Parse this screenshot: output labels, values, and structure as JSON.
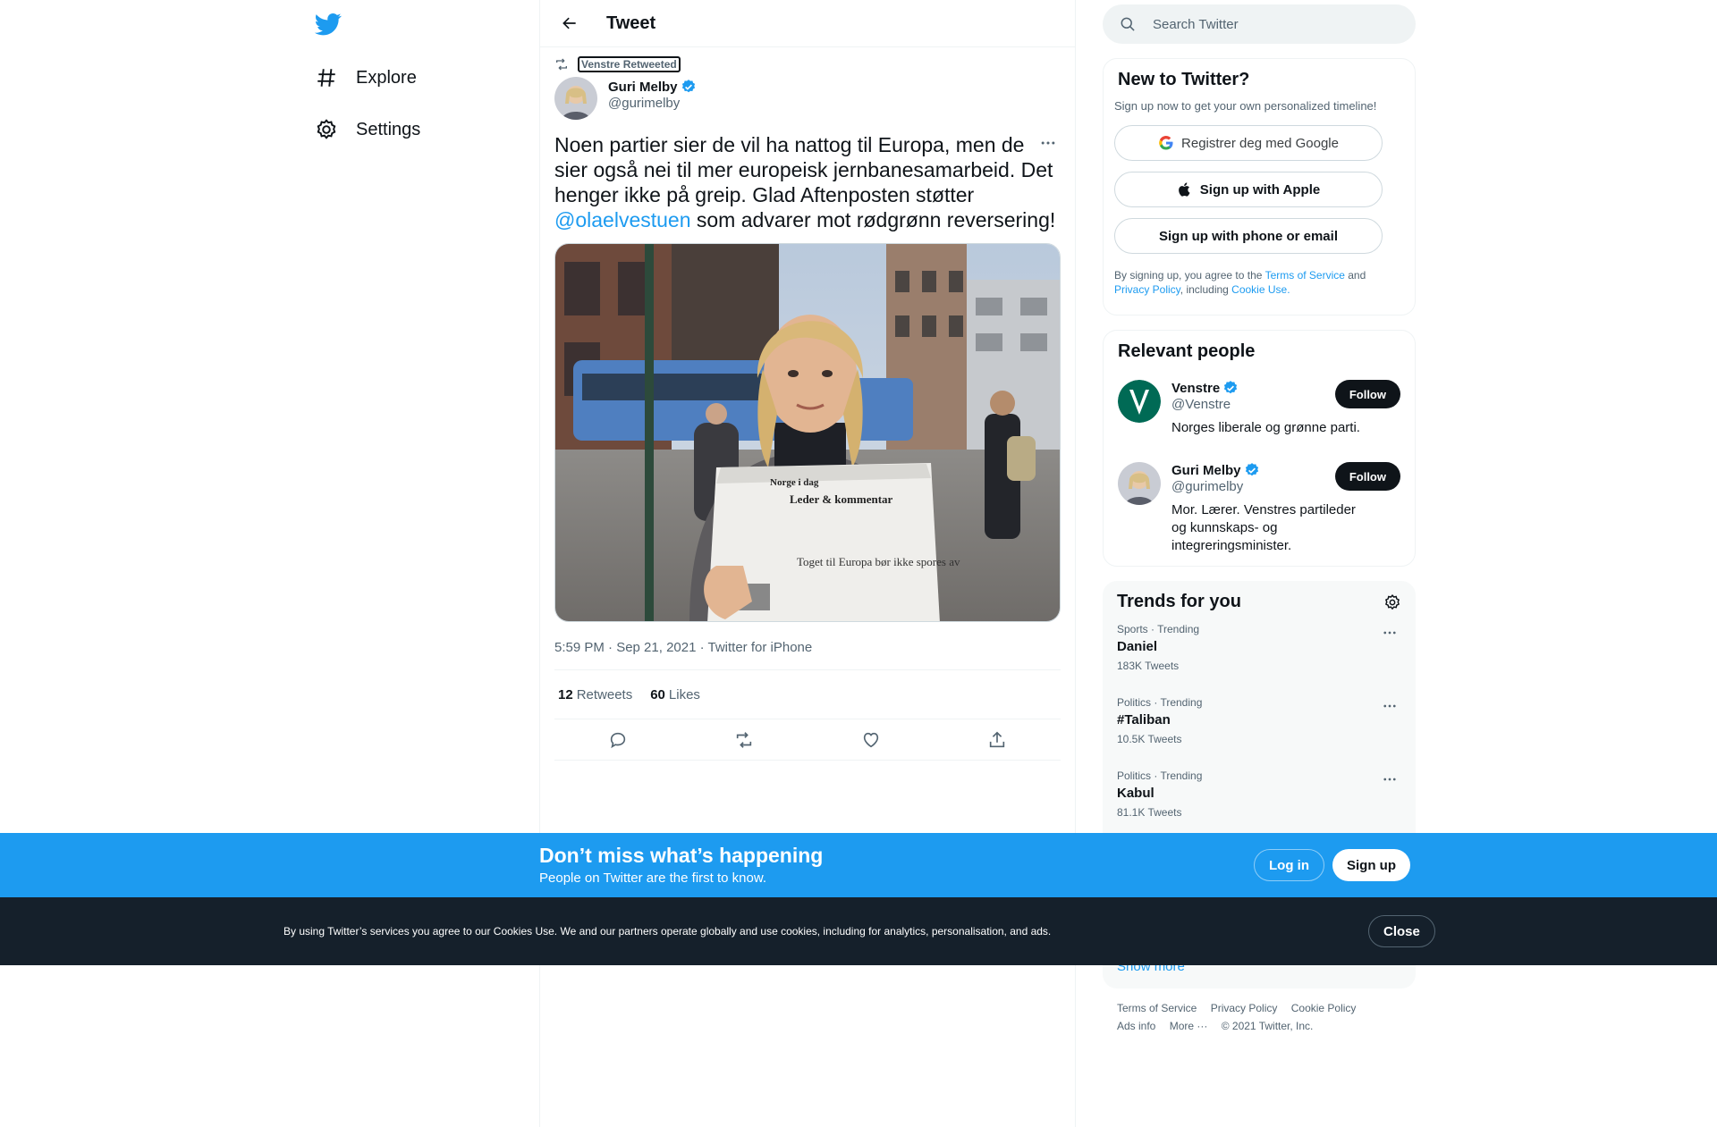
{
  "nav": {
    "explore_label": "Explore",
    "settings_label": "Settings"
  },
  "header": {
    "title": "Tweet"
  },
  "tweet": {
    "retweeted_by": "Venstre Retweeted",
    "author_name": "Guri Melby",
    "author_handle": "@gurimelby",
    "text_before": "Noen partier sier de vil ha nattog til Europa, men de sier også nei til mer europeisk jernbanesamarbeid. Det henger ikke på greip. Glad Aftenposten støtter ",
    "mention": "@olaelvestuen",
    "text_after": " som advarer mot rødgrønn reversering!",
    "image_text_1": "Leder & kommentar",
    "image_text_2": "Toget til Europa bør ikke spores av",
    "image_text_3": "Norge i dag",
    "meta": "5:59 PM · Sep 21, 2021 · Twitter for iPhone",
    "retweets_count": "12",
    "retweets_label": "Retweets",
    "likes_count": "60",
    "likes_label": "Likes"
  },
  "search": {
    "placeholder": "Search Twitter"
  },
  "new_to_twitter": {
    "title": "New to Twitter?",
    "subtitle": "Sign up now to get your own personalized timeline!",
    "google_label": "Registrer deg med Google",
    "apple_label": "Sign up with Apple",
    "phone_label": "Sign up with phone or email",
    "terms_1": "By signing up, you agree to the ",
    "terms_tos": "Terms of Service",
    "terms_2": " and ",
    "terms_privacy": "Privacy Policy",
    "terms_3": ", including ",
    "terms_cookie": "Cookie Use."
  },
  "relevant_people": {
    "title": "Relevant people",
    "people": [
      {
        "name": "Venstre",
        "handle": "@Venstre",
        "bio": "Norges liberale og grønne parti.",
        "follow": "Follow"
      },
      {
        "name": "Guri Melby",
        "handle": "@gurimelby",
        "bio": "Mor. Lærer. Venstres partileder og kunnskaps- og integreringsminister.",
        "follow": "Follow"
      }
    ]
  },
  "trends": {
    "title": "Trends for you",
    "items": [
      {
        "category": "Sports · Trending",
        "name": "Daniel",
        "count": "183K Tweets"
      },
      {
        "category": "Politics · Trending",
        "name": "#Taliban",
        "count": "10.5K Tweets"
      },
      {
        "category": "Politics · Trending",
        "name": "Kabul",
        "count": "81.1K Tweets"
      }
    ],
    "show_more": "Show more"
  },
  "footer": {
    "links": [
      "Terms of Service",
      "Privacy Policy",
      "Cookie Policy",
      "Ads info",
      "More ···"
    ],
    "copyright": "© 2021 Twitter, Inc."
  },
  "banner": {
    "title": "Don’t miss what’s happening",
    "subtitle": "People on Twitter are the first to know.",
    "login": "Log in",
    "signup": "Sign up"
  },
  "cookie": {
    "text": "By using Twitter’s services you agree to our Cookies Use. We and our partners operate globally and use cookies, including for analytics, personalisation, and ads.",
    "close": "Close"
  },
  "colors": {
    "accent": "#1d9bf0",
    "text": "#0f1419",
    "secondary": "#536471",
    "cookie_bg": "#15202b"
  }
}
